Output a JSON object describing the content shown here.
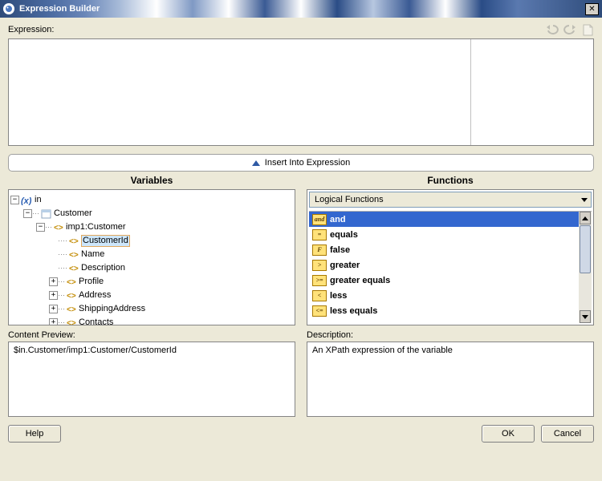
{
  "window": {
    "title": "Expression Builder"
  },
  "labels": {
    "expression": "Expression:",
    "insert": "Insert Into Expression",
    "variables": "Variables",
    "functions": "Functions",
    "content_preview": "Content Preview:",
    "description": "Description:"
  },
  "buttons": {
    "help": "Help",
    "ok": "OK",
    "cancel": "Cancel"
  },
  "functions_category": "Logical Functions",
  "functions": [
    {
      "badge": "and",
      "name": "and",
      "selected": true
    },
    {
      "badge": "=",
      "name": "equals"
    },
    {
      "badge": "F",
      "name": "false"
    },
    {
      "badge": ">",
      "name": "greater"
    },
    {
      "badge": ">=",
      "name": "greater equals"
    },
    {
      "badge": "<",
      "name": "less"
    },
    {
      "badge": "<=",
      "name": "less equals"
    }
  ],
  "tree": {
    "root": "in",
    "customer": "Customer",
    "imp1": "imp1:Customer",
    "customerid": "CustomerId",
    "name": "Name",
    "description": "Description",
    "profile": "Profile",
    "address": "Address",
    "shipping": "ShippingAddress",
    "contacts": "Contacts"
  },
  "preview_text": "$in.Customer/imp1:Customer/CustomerId",
  "description_text": "An XPath expression of the variable"
}
